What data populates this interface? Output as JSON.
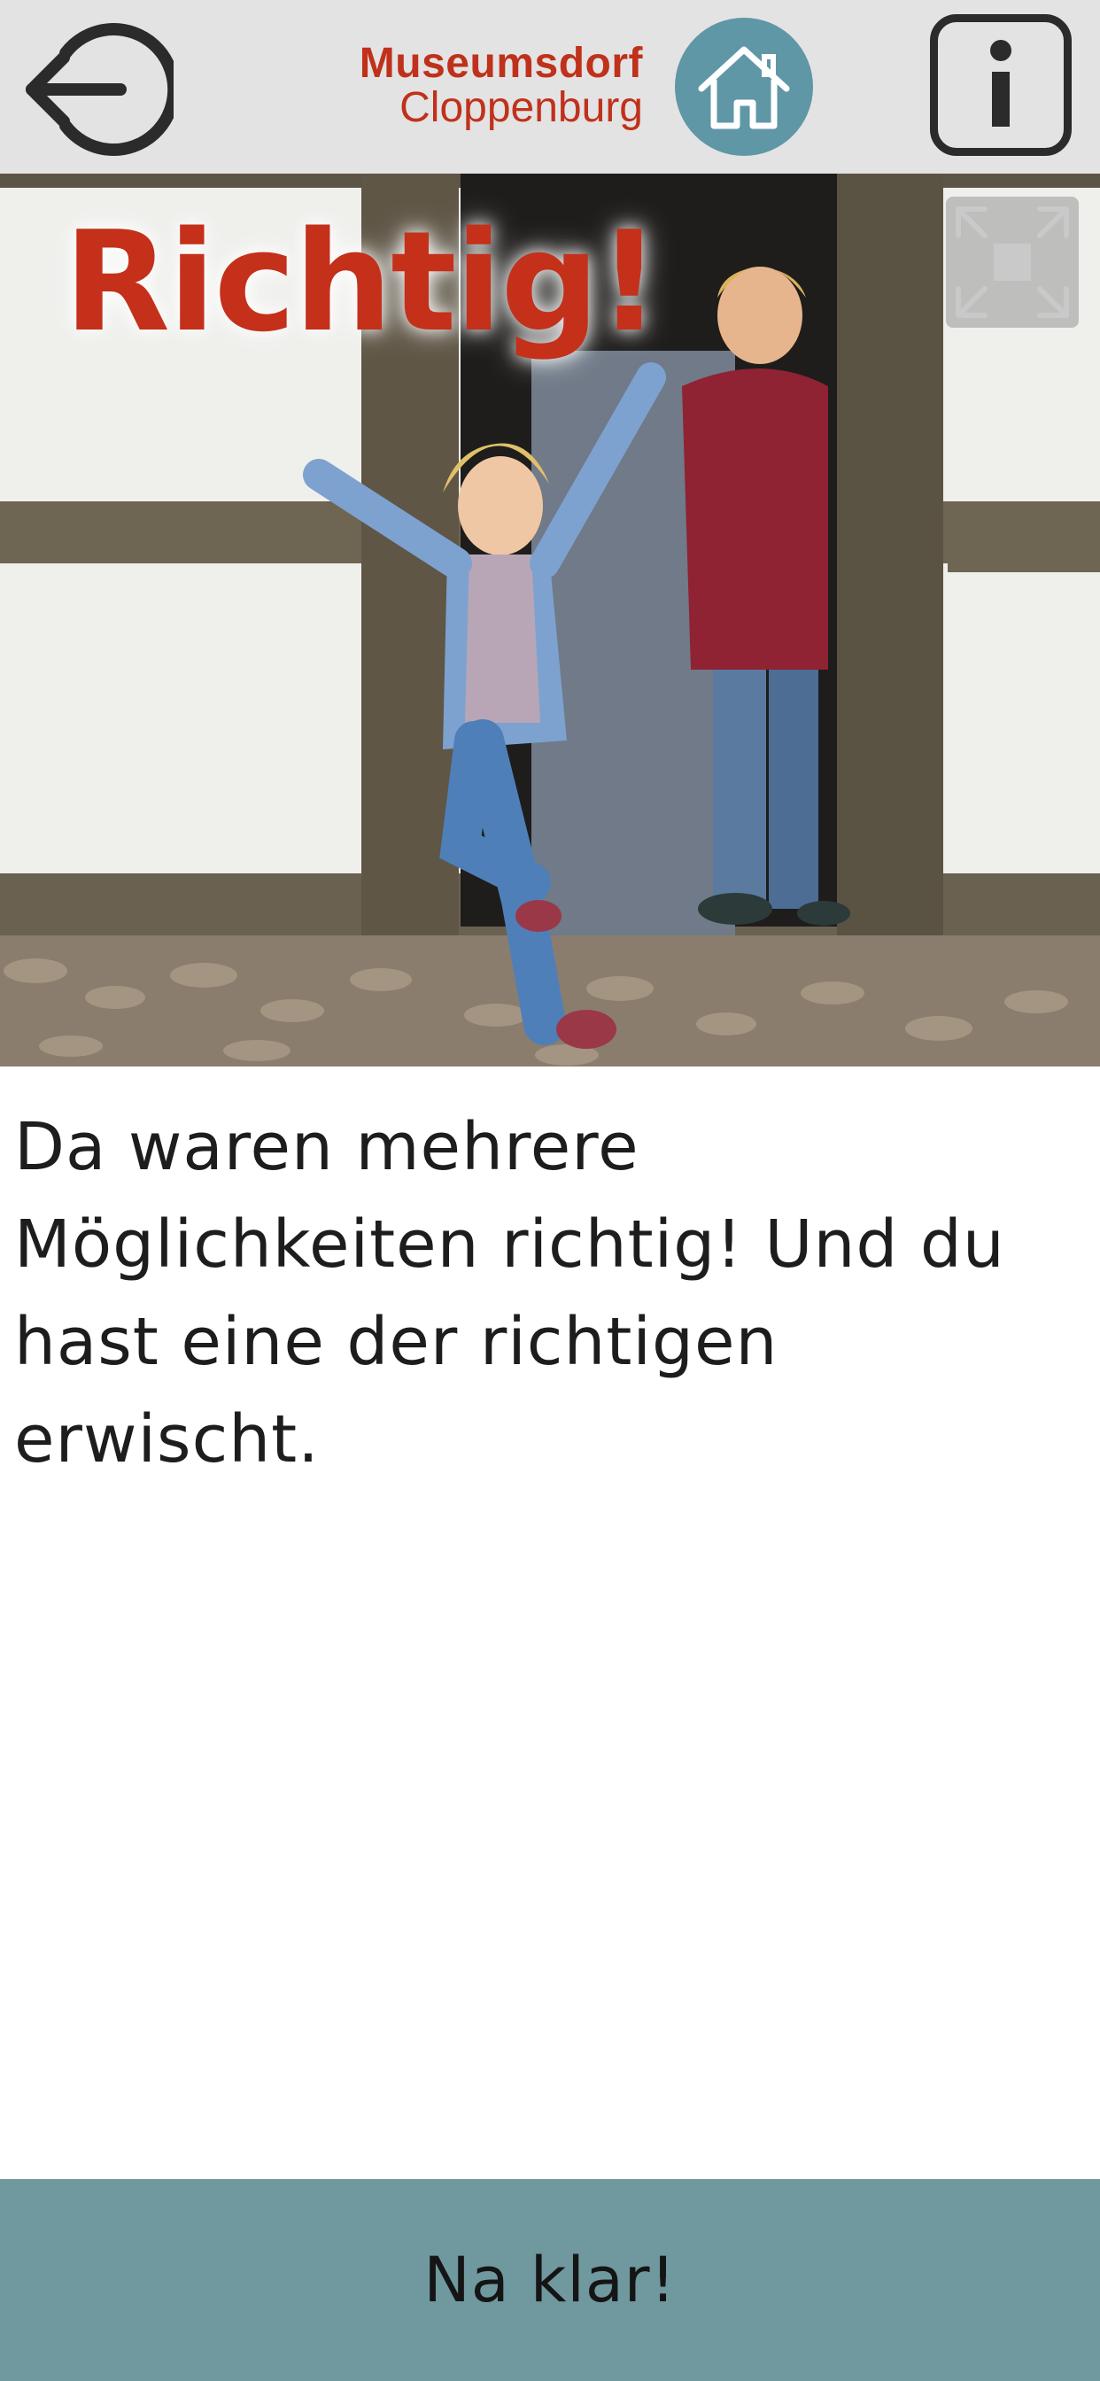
{
  "header": {
    "brand_line1": "Museumsdorf",
    "brand_line2": "Cloppenburg",
    "back_icon": "logout-arrow-icon",
    "home_icon": "house-icon",
    "info_icon": "info-icon"
  },
  "result": {
    "title": "Richtig!",
    "message": "Da waren mehrere Möglichkeiten richtig! Und du hast eine der richtigen erwischt.",
    "fullscreen_icon": "fullscreen-expand-icon"
  },
  "footer": {
    "button_label": "Na klar!"
  },
  "colors": {
    "header_bg": "#e3e3e3",
    "brand": "#c0311b",
    "home_circle": "#5f97a6",
    "title": "#c4301a",
    "footer_bg": "#6f999f"
  }
}
